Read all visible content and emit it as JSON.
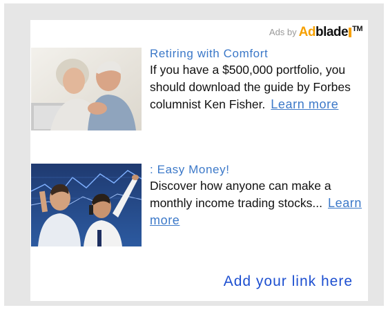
{
  "header": {
    "ads_by": "Ads by",
    "brand_ad": "Ad",
    "brand_blade": "blade",
    "brand_tm": "TM"
  },
  "ads": [
    {
      "image": "couple-photo",
      "title": "Retiring with Comfort",
      "body": "If you have a $500,000 portfolio, you should download the guide by Forbes columnist Ken Fisher.",
      "link": "Learn more"
    },
    {
      "image": "traders-photo",
      "title": ": Easy Money!",
      "body": "Discover how anyone can make a monthly income trading stocks...",
      "link": "Learn more"
    }
  ],
  "footer": {
    "add_link": "Add your link here"
  },
  "colors": {
    "frame": "#e6e6e6",
    "title": "#3b78c8",
    "link": "#3b78c8",
    "add_link": "#1d4fd0",
    "brand_orange": "#f6a000"
  }
}
